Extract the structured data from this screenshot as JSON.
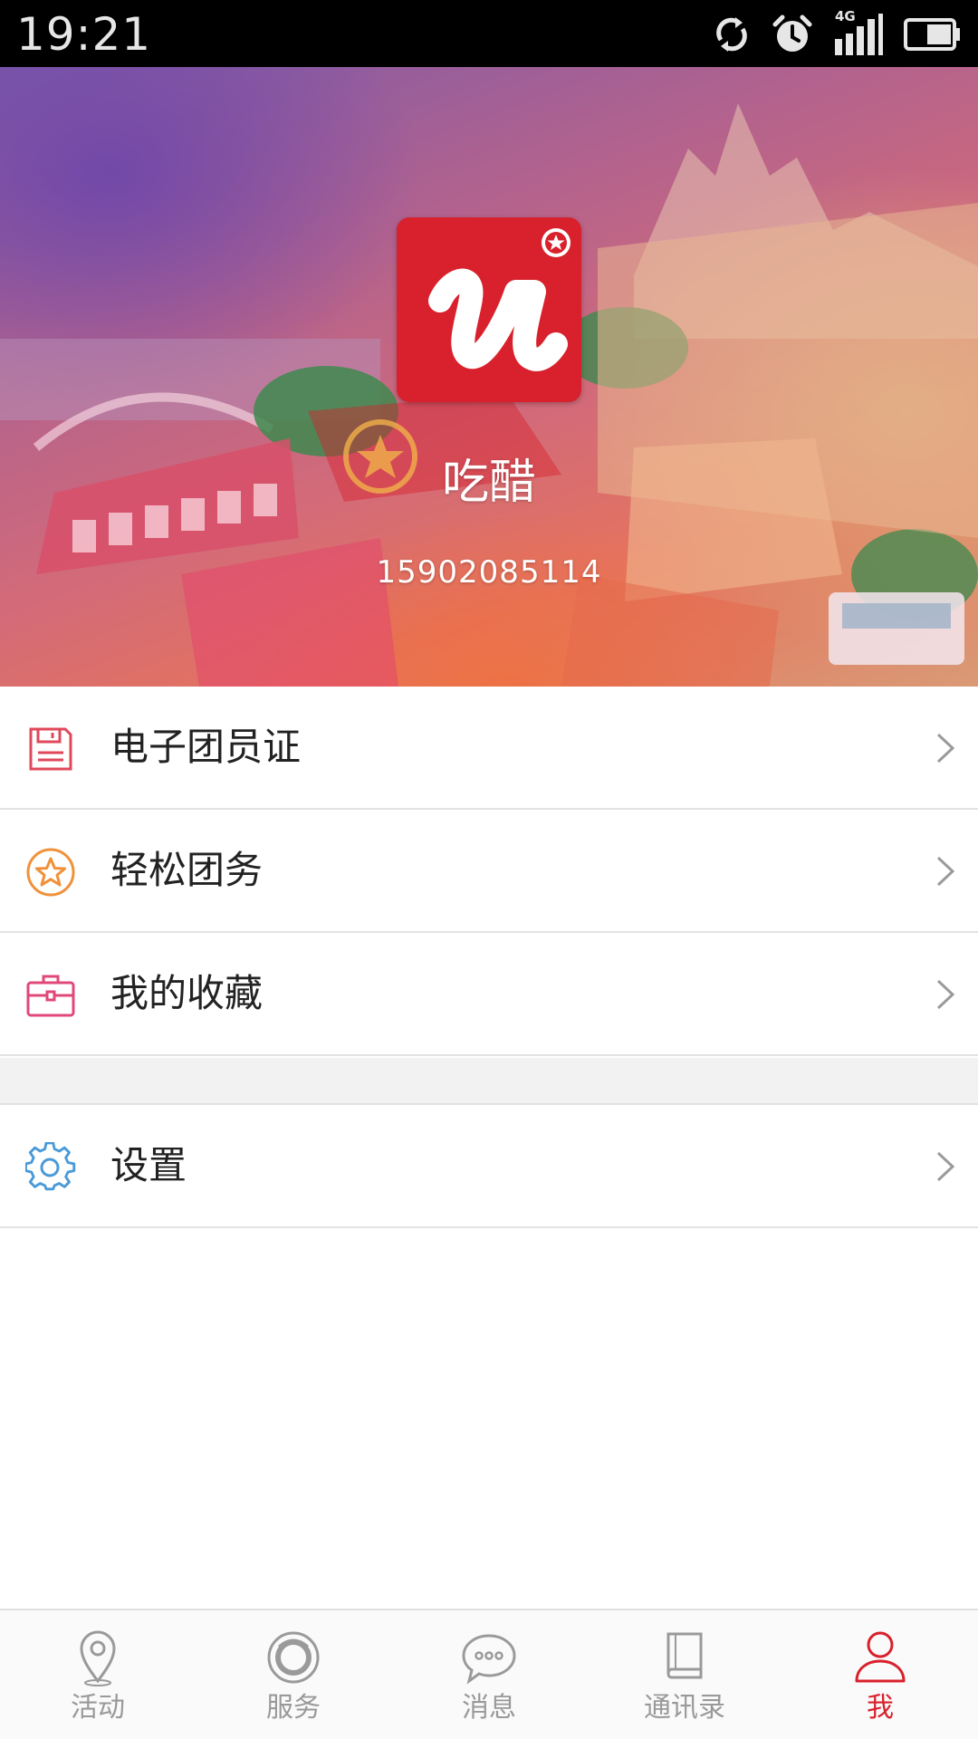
{
  "status_bar": {
    "time": "19:21",
    "network": "4G",
    "icons": [
      "sync-icon",
      "alarm-icon",
      "signal-icon",
      "battery-icon"
    ]
  },
  "profile": {
    "logo_icon": "u-logo-icon",
    "name": "吃醋",
    "phone": "15902085114"
  },
  "menu": {
    "items": [
      {
        "label": "电子团员证",
        "icon": "floppy-card-icon",
        "color": "#e0485a"
      },
      {
        "label": "轻松团务",
        "icon": "star-circle-icon",
        "color": "#f0913a"
      },
      {
        "label": "我的收藏",
        "icon": "briefcase-icon",
        "color": "#e0487a"
      }
    ],
    "settings": {
      "label": "设置",
      "icon": "gear-icon",
      "color": "#4a9ad8"
    }
  },
  "bottom_nav": {
    "items": [
      {
        "label": "活动",
        "icon": "location-pin-icon"
      },
      {
        "label": "服务",
        "icon": "service-ring-icon"
      },
      {
        "label": "消息",
        "icon": "chat-bubble-icon"
      },
      {
        "label": "通讯录",
        "icon": "address-book-icon"
      },
      {
        "label": "我",
        "icon": "person-icon"
      }
    ],
    "active_index": 4,
    "active_color": "#d8212c",
    "inactive_color": "#999999"
  }
}
